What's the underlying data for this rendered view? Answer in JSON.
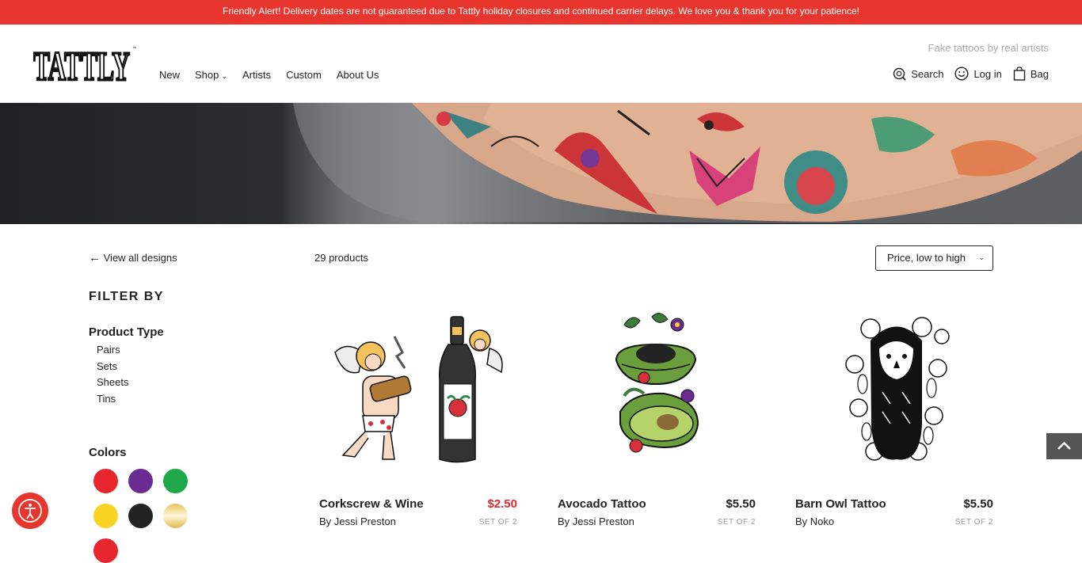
{
  "alert": {
    "text": "Friendly Alert! Delivery dates are not guaranteed due to Tattly holiday closures and continued carrier delays. We love you & thank you for your patience!"
  },
  "header": {
    "logo_text": "TATTLY",
    "tagline": "Fake tattoos by real artists",
    "nav": [
      "New",
      "Shop",
      "Artists",
      "Custom",
      "About Us"
    ],
    "search_label": "Search",
    "login_label": "Log in",
    "bag_label": "Bag"
  },
  "sidebar": {
    "back_label": "View all designs",
    "filter_title": "FILTER BY",
    "product_type_title": "Product Type",
    "product_types": [
      "Pairs",
      "Sets",
      "Sheets",
      "Tins"
    ],
    "colors_title": "Colors",
    "colors": [
      "#e8262e",
      "#6a2c91",
      "#1fa84a",
      "#f9d423",
      "#222222",
      "gold-gradient"
    ]
  },
  "listing": {
    "count": "29 products",
    "sort_value": "Price, low to high"
  },
  "products": [
    {
      "name": "Corkscrew & Wine",
      "artist": "By Jessi Preston",
      "price": "$2.50",
      "set": "SET OF 2",
      "sale": true
    },
    {
      "name": "Avocado Tattoo",
      "artist": "By Jessi Preston",
      "price": "$5.50",
      "set": "SET OF 2",
      "sale": false
    },
    {
      "name": "Barn Owl Tattoo",
      "artist": "By Noko",
      "price": "$5.50",
      "set": "SET OF 2",
      "sale": false
    }
  ],
  "theme": {
    "accent": "#e8362f",
    "sale_color": "#e8262e"
  }
}
